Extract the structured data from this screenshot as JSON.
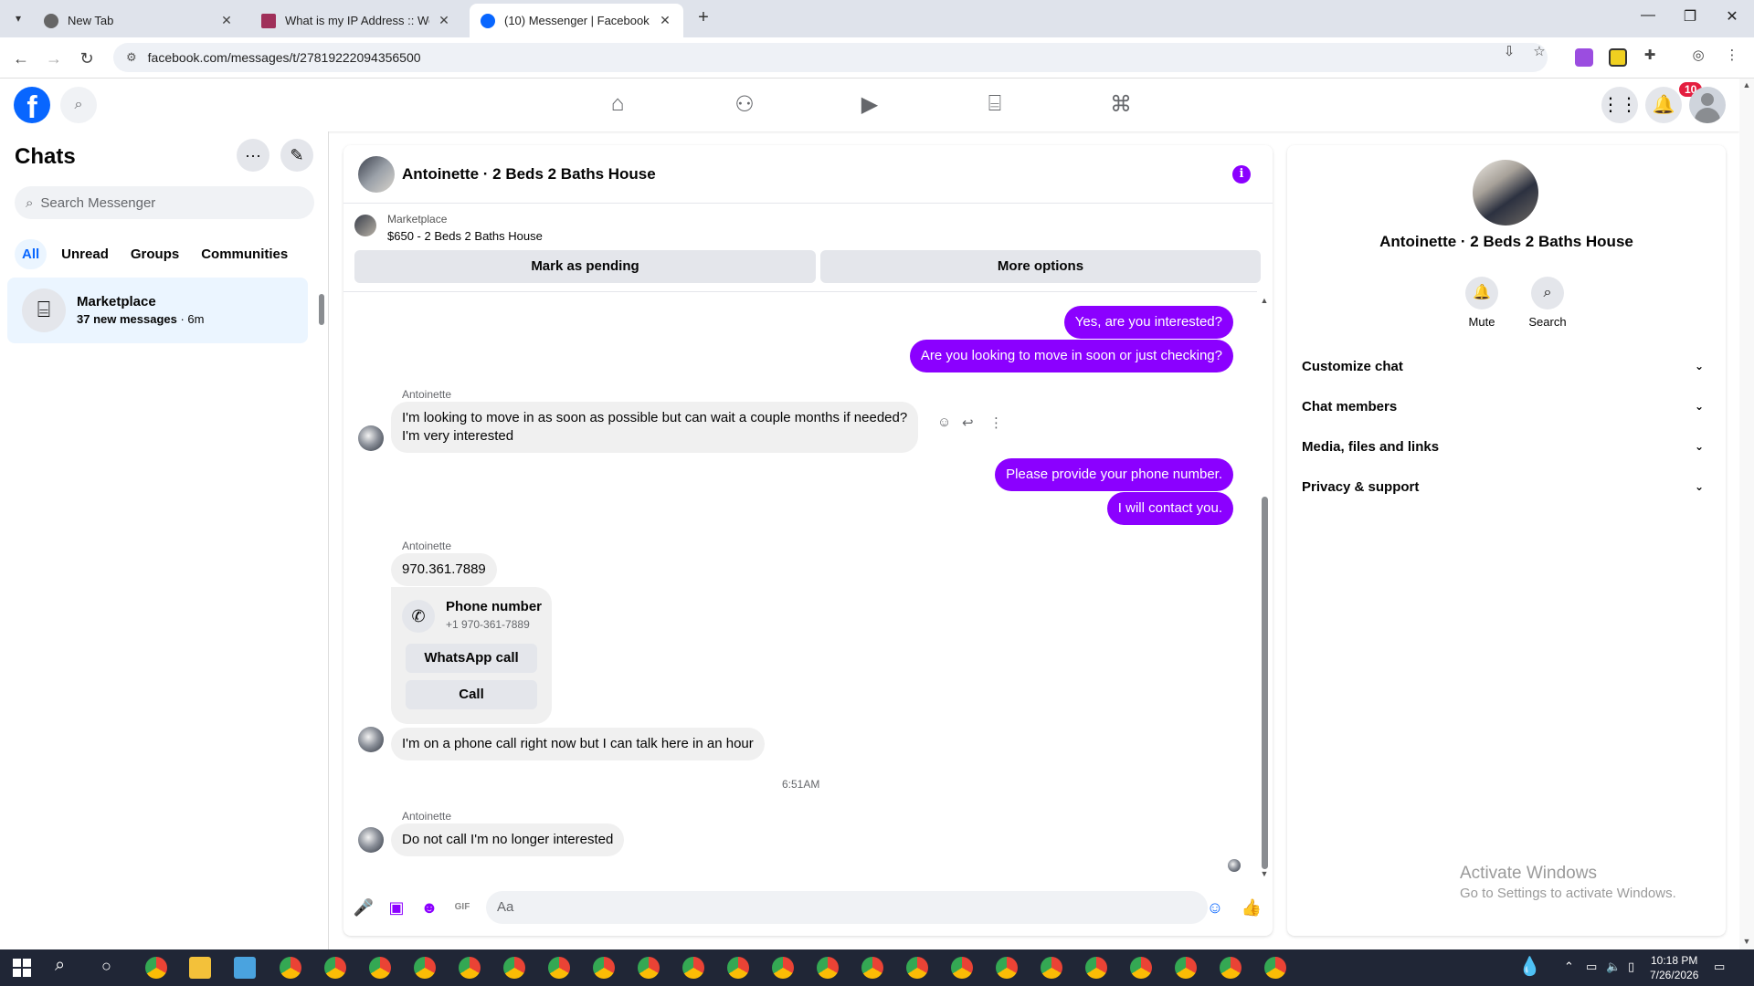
{
  "browser": {
    "tabs": [
      {
        "title": "New Tab",
        "active": false
      },
      {
        "title": "What is my IP Address :: WebBr",
        "active": false
      },
      {
        "title": "(10) Messenger | Facebook",
        "active": true
      }
    ],
    "url": "facebook.com/messages/t/27819222094356500"
  },
  "fb_header": {
    "logo": "f",
    "notification_count": "10",
    "nav_icons": [
      "home-icon",
      "friends-icon",
      "video-icon",
      "marketplace-icon",
      "gaming-icon"
    ]
  },
  "chats": {
    "title": "Chats",
    "search_placeholder": "Search Messenger",
    "filters": [
      "All",
      "Unread",
      "Groups",
      "Communities"
    ],
    "items": [
      {
        "name": "Marketplace",
        "sub_bold": "37 new messages",
        "sub_time": " · 6m"
      }
    ]
  },
  "conversation": {
    "title": "Antoinette · 2 Beds 2 Baths House",
    "marketplace_label": "Marketplace",
    "listing": "$650 - 2 Beds 2 Baths House",
    "mark_pending": "Mark as pending",
    "more_options": "More options",
    "messages": {
      "out1": "Yes, are you interested?",
      "out2": "Are you looking to move in soon or just checking?",
      "sender1": "Antoinette",
      "in1_line1": "I'm looking to move in as soon as possible but can wait a couple months if needed?",
      "in1_line2": "I'm very interested",
      "out3": "Please provide your phone number.",
      "out4": "I will contact you.",
      "sender2": "Antoinette",
      "in2": "970.361.7889",
      "phone_label": "Phone number",
      "phone_number": "+1 970-361-7889",
      "whatsapp_call": "WhatsApp call",
      "call": "Call",
      "in3": "I'm on a phone call right now but I can talk here in an hour",
      "timestamp": "6:51AM",
      "sender3": "Antoinette",
      "in4": "Do not call I'm no longer interested"
    },
    "composer_placeholder": "Aa"
  },
  "info_panel": {
    "name": "Antoinette · 2 Beds 2 Baths House",
    "actions": [
      "Mute",
      "Search"
    ],
    "sections": [
      "Customize chat",
      "Chat members",
      "Media, files and links",
      "Privacy & support"
    ]
  },
  "watermark": {
    "line1": "Activate Windows",
    "line2": "Go to Settings to activate Windows."
  },
  "taskbar": {
    "time": "10:18 PM",
    "date": "7/26/2026"
  },
  "colors": {
    "accent_purple": "#8b00ff",
    "fb_blue": "#0866ff",
    "badge_red": "#e41e3f"
  }
}
